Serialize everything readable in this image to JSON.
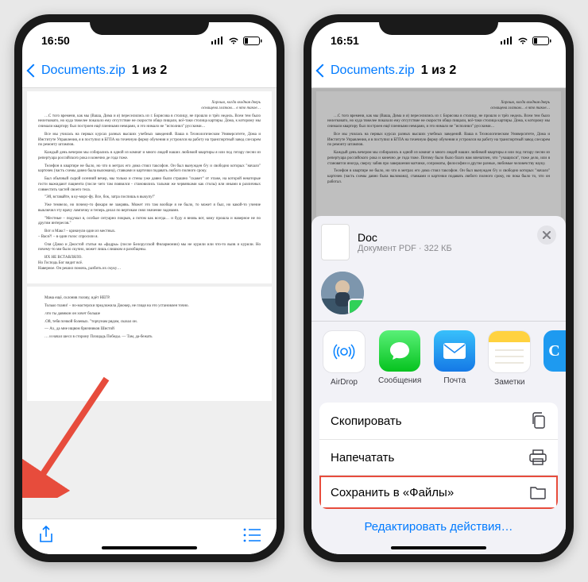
{
  "left": {
    "status": {
      "time": "16:50"
    },
    "nav": {
      "back": "Documents.zip",
      "title": "1 из 2"
    }
  },
  "right": {
    "status": {
      "time": "16:51"
    },
    "nav": {
      "back": "Documents.zip",
      "title": "1 из 2"
    },
    "sheet": {
      "doc": {
        "name": "Doc",
        "meta": "Документ PDF · 322 КБ"
      },
      "apps": {
        "airdrop": "AirDrop",
        "messages": "Сообщения",
        "mail": "Почта",
        "notes": "Заметки"
      },
      "actions": {
        "copy": "Скопировать",
        "print": "Напечатать",
        "saveToFiles": "Сохранить в «Файлы»"
      },
      "editActions": "Редактировать действия…"
    }
  }
}
